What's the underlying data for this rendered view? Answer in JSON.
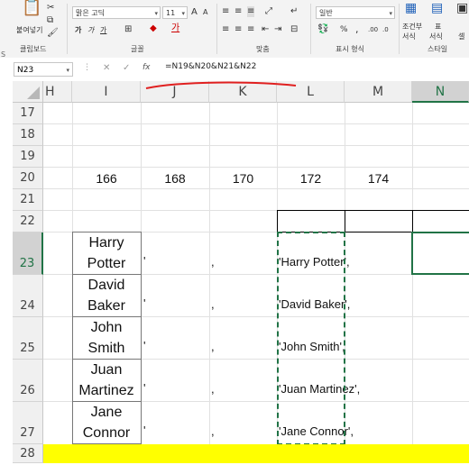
{
  "ribbon": {
    "clipboard_group": "클립보드",
    "paste_label": "붙여넣기",
    "font_group": "글꼴",
    "font_name": "맑은 고딕",
    "font_size": "11",
    "bold": "가",
    "italic": "가",
    "underline": "가",
    "align_group": "맞춤",
    "number_group": "표시 형식",
    "number_format": "일반",
    "percent": "%",
    "comma": ",",
    "cond_format": "조건부 서식",
    "cond_format_label": "조건부",
    "cond_format_sub": "서식",
    "table_format_label": "표",
    "table_format_sub": "서식",
    "cell_style_label": "셀",
    "style_group": "스타일",
    "edge_char": "S"
  },
  "formula_bar": {
    "name_box": "N23",
    "fx": "fx",
    "formula": "=N19&N20&N21&N22"
  },
  "columns": [
    "H",
    "I",
    "J",
    "K",
    "L",
    "M",
    "N"
  ],
  "selected_column": "N",
  "rows": [
    "17",
    "18",
    "19",
    "20",
    "21",
    "22",
    "23",
    "24",
    "25",
    "26",
    "27",
    "28"
  ],
  "selected_row": "23",
  "row20_values": [
    "166",
    "168",
    "170",
    "172",
    "174"
  ],
  "names": [
    {
      "line1": "Harry",
      "line2": "Potter"
    },
    {
      "line1": "David",
      "line2": "Baker"
    },
    {
      "line1": "John",
      "line2": "Smith"
    },
    {
      "line1": "Juan",
      "line2": "Martinez"
    },
    {
      "line1": "Jane",
      "line2": "Connor"
    }
  ],
  "col_j_text": "'",
  "col_k_text": ",",
  "col_l_texts": [
    "'Harry Potter',",
    "'David Baker',",
    "'John Smith',",
    "'Juan Martinez',",
    "'Jane Connor',"
  ],
  "colors": {
    "accent": "#217346",
    "highlight_row": "#ffff00",
    "annotation": "#e02020"
  }
}
